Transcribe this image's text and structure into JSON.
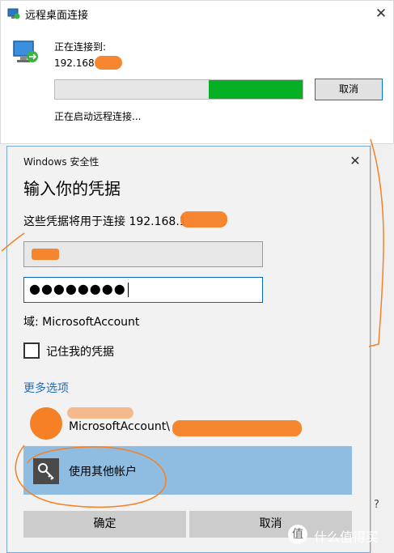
{
  "remote_desktop": {
    "title": "远程桌面连接",
    "close": "✕",
    "connecting_to": "正在连接到:",
    "ip": "192.168.",
    "progress_fraction": 0.38,
    "cancel_label": "取消",
    "status": "正在启动远程连接..."
  },
  "dialog": {
    "title": "Windows 安全性",
    "close": "✕",
    "heading": "输入你的凭据",
    "subtitle": "这些凭据将用于连接 192.168.1",
    "username_value": "",
    "password_mask": "●●●●●●●●",
    "domain": "域: MicrosoftAccount",
    "remember_label": "记住我的凭据",
    "remember_checked": false,
    "more_options": "更多选项",
    "account1": {
      "name": "",
      "domain": "MicrosoftAccount\\"
    },
    "account2_label": "使用其他帐户",
    "ok_label": "确定",
    "cancel_label": "取消"
  },
  "background": {
    "help": "?"
  },
  "watermark": {
    "text": "什么值得买",
    "glyph": "值"
  },
  "colors": {
    "progress_green": "#06b025",
    "selected_account": "#8fbde2",
    "link_blue": "#1a6fc4",
    "redaction_orange": "#f58025"
  }
}
